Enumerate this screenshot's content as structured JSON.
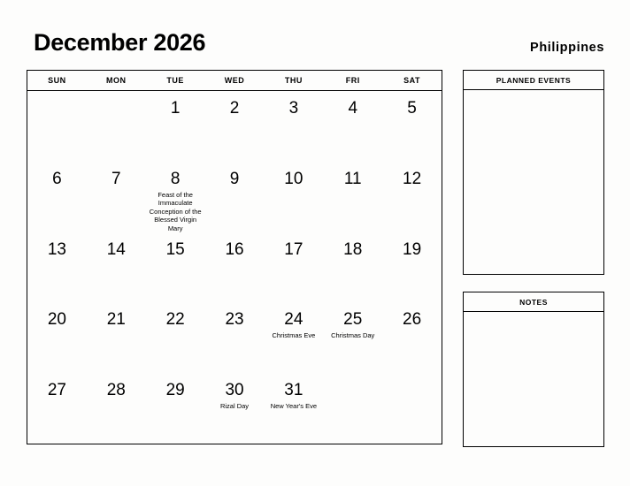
{
  "header": {
    "title": "December 2026",
    "country": "Philippines"
  },
  "calendar": {
    "weekdays": [
      "SUN",
      "MON",
      "TUE",
      "WED",
      "THU",
      "FRI",
      "SAT"
    ],
    "weeks": [
      [
        {
          "day": "",
          "event": ""
        },
        {
          "day": "",
          "event": ""
        },
        {
          "day": "1",
          "event": ""
        },
        {
          "day": "2",
          "event": ""
        },
        {
          "day": "3",
          "event": ""
        },
        {
          "day": "4",
          "event": ""
        },
        {
          "day": "5",
          "event": ""
        }
      ],
      [
        {
          "day": "6",
          "event": ""
        },
        {
          "day": "7",
          "event": ""
        },
        {
          "day": "8",
          "event": "Feast of the Immaculate Conception of the Blessed Virgin Mary"
        },
        {
          "day": "9",
          "event": ""
        },
        {
          "day": "10",
          "event": ""
        },
        {
          "day": "11",
          "event": ""
        },
        {
          "day": "12",
          "event": ""
        }
      ],
      [
        {
          "day": "13",
          "event": ""
        },
        {
          "day": "14",
          "event": ""
        },
        {
          "day": "15",
          "event": ""
        },
        {
          "day": "16",
          "event": ""
        },
        {
          "day": "17",
          "event": ""
        },
        {
          "day": "18",
          "event": ""
        },
        {
          "day": "19",
          "event": ""
        }
      ],
      [
        {
          "day": "20",
          "event": ""
        },
        {
          "day": "21",
          "event": ""
        },
        {
          "day": "22",
          "event": ""
        },
        {
          "day": "23",
          "event": ""
        },
        {
          "day": "24",
          "event": "Christmas Eve"
        },
        {
          "day": "25",
          "event": "Christmas Day"
        },
        {
          "day": "26",
          "event": ""
        }
      ],
      [
        {
          "day": "27",
          "event": ""
        },
        {
          "day": "28",
          "event": ""
        },
        {
          "day": "29",
          "event": ""
        },
        {
          "day": "30",
          "event": "Rizal Day"
        },
        {
          "day": "31",
          "event": "New Year's Eve"
        },
        {
          "day": "",
          "event": ""
        },
        {
          "day": "",
          "event": ""
        }
      ]
    ]
  },
  "panels": {
    "planned_events": {
      "title": "PLANNED EVENTS",
      "body": ""
    },
    "notes": {
      "title": "NOTES",
      "body": ""
    }
  }
}
